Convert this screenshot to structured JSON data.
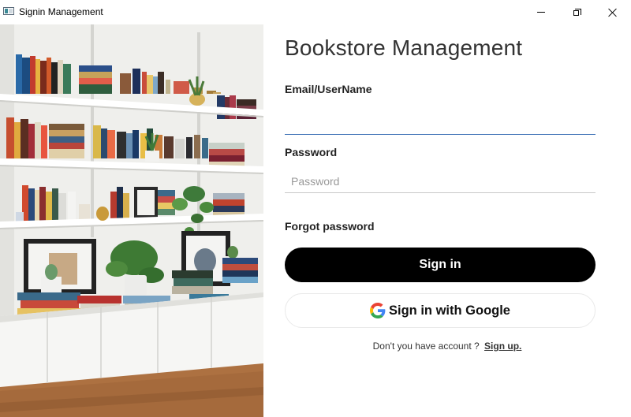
{
  "window": {
    "title": "Signin Management",
    "controls": [
      "minimize-icon",
      "restore-icon",
      "close-icon"
    ]
  },
  "hero": {
    "image": "bookshelf-photo"
  },
  "form": {
    "heading": "Bookstore Management",
    "email_label": "Email/UserName",
    "email_value": "",
    "email_placeholder": "",
    "password_label": "Password",
    "password_placeholder": "Password",
    "forgot_password": "Forgot password",
    "signin_label": "Sign in",
    "google_label": "Sign in with Google",
    "signup_prompt": "Don't you have account ?",
    "signup_link": "Sign up."
  },
  "colors": {
    "primary_button": "#000000",
    "focus_underline": "#3a6fb5",
    "heading": "#333333"
  }
}
